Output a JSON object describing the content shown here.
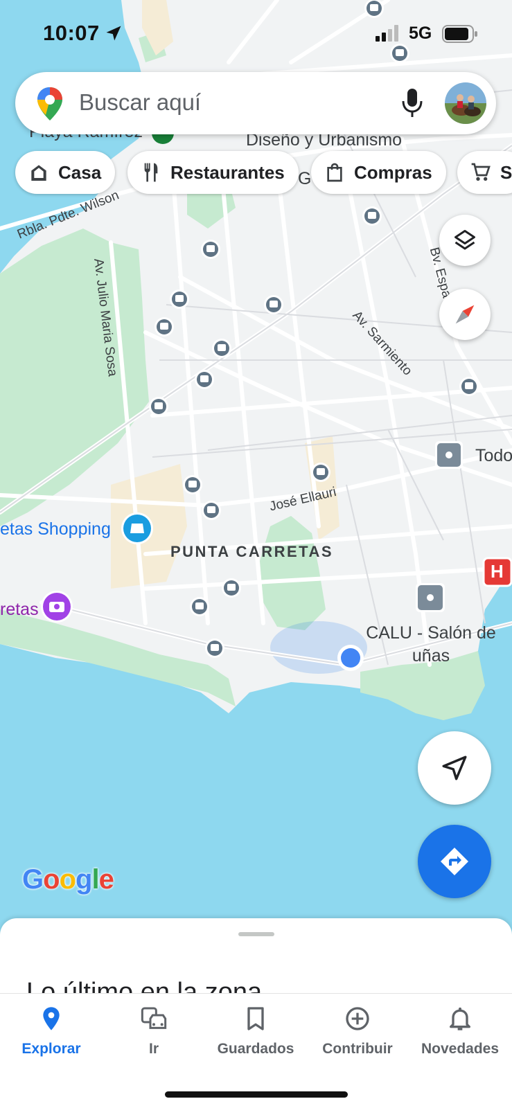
{
  "status_bar": {
    "time": "10:07",
    "network": "5G"
  },
  "search": {
    "placeholder": "Buscar aquí"
  },
  "chips": [
    {
      "label": "Casa",
      "icon": "home-icon"
    },
    {
      "label": "Restaurantes",
      "icon": "fork-knife-icon"
    },
    {
      "label": "Compras",
      "icon": "shopping-bag-icon"
    },
    {
      "label": "S",
      "icon": "cart-icon"
    }
  ],
  "map": {
    "streets": [
      "Rbla. Pdte. Wilson",
      "Av. Julio Maria Sosa",
      "Av. Sarmiento",
      "Bv. Espa",
      "José Ellauri"
    ],
    "top_labels": [
      "Playa Ramírez",
      "Diseño y Urbanismo",
      "G"
    ],
    "neighborhood": "PUNTA CARRETAS",
    "pois": {
      "shopping": "etas Shopping",
      "retas": "retas",
      "todo": "Todo",
      "calu_line1": "CALU - Salón de",
      "calu_line2": "uñas"
    },
    "hospital_letter": "H",
    "colors": {
      "water": "#8ed8ef",
      "park": "#bfe7c7",
      "land": "#f1f3f4",
      "road": "#ffffff",
      "accent": "#1a73e8"
    }
  },
  "google_logo": {
    "letters": [
      "G",
      "o",
      "o",
      "g",
      "l",
      "e"
    ],
    "colors": [
      "#4285f4",
      "#ea4335",
      "#fbbc05",
      "#4285f4",
      "#34a853",
      "#ea4335"
    ]
  },
  "sheet": {
    "title": "Lo último en la zona"
  },
  "nav": [
    {
      "label": "Explorar",
      "icon": "explore-pin-icon",
      "active": true
    },
    {
      "label": "Ir",
      "icon": "commute-icon",
      "active": false
    },
    {
      "label": "Guardados",
      "icon": "bookmark-icon",
      "active": false
    },
    {
      "label": "Contribuir",
      "icon": "add-circle-icon",
      "active": false
    },
    {
      "label": "Novedades",
      "icon": "bell-icon",
      "active": false
    }
  ]
}
